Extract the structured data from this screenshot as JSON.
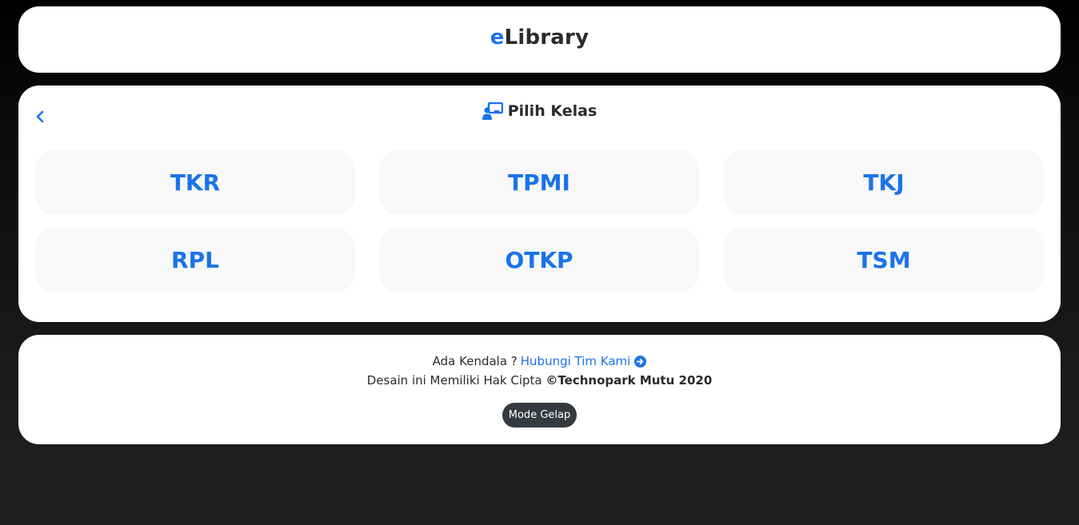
{
  "header": {
    "brand_accent": "e",
    "brand_rest": "Library"
  },
  "main": {
    "back_icon": "chevron-left-icon",
    "title_icon": "chalkboard-user-icon",
    "title": "Pilih Kelas",
    "classes": [
      {
        "label": "TKR"
      },
      {
        "label": "TPMI"
      },
      {
        "label": "TKJ"
      },
      {
        "label": "RPL"
      },
      {
        "label": "OTKP"
      },
      {
        "label": "TSM"
      }
    ]
  },
  "footer": {
    "problem_text": "Ada Kendala ?",
    "contact_link": "Hubungi Tim Kami",
    "contact_icon": "arrow-circle-right-icon",
    "copyright_prefix": "Desain ini Memiliki Hak Cipta ",
    "copyright_strong": "©Technopark Mutu 2020",
    "mode_button": "Mode Gelap"
  },
  "colors": {
    "accent": "#1a73e8",
    "card_bg": "#ffffff",
    "tile_bg": "#f8f8f8",
    "dark_button": "#343a40"
  }
}
